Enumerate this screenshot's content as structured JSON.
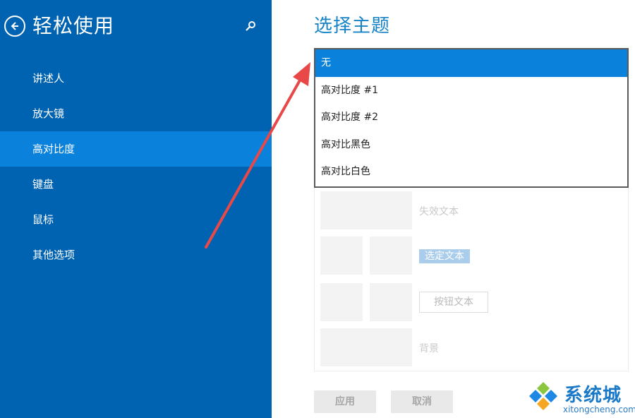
{
  "nav": {
    "title": "轻松使用",
    "items": [
      {
        "label": "讲述人"
      },
      {
        "label": "放大镜"
      },
      {
        "label": "高对比度",
        "active": true
      },
      {
        "label": "键盘"
      },
      {
        "label": "鼠标"
      },
      {
        "label": "其他选项"
      }
    ],
    "background": "#0063b1",
    "active_color": "#0a82dc"
  },
  "main": {
    "title": "选择主题",
    "theme_options": [
      "无",
      "高对比度 #1",
      "高对比度 #2",
      "高对比黑色",
      "高对比白色"
    ],
    "selected_theme": "无",
    "preview": {
      "disabled_text": "失效文本",
      "selected_text": "选定文本",
      "button_text": "按钮文本",
      "background": "背景"
    },
    "apply_label": "应用",
    "cancel_label": "取消"
  },
  "watermark": {
    "brand": "系统城",
    "url": "xitongcheng.com"
  },
  "icons": {
    "back": "back-arrow-icon",
    "search": "search-icon"
  },
  "colors": {
    "accent": "#0a82dc",
    "title": "#1783c6",
    "annotation": "#e84848"
  }
}
